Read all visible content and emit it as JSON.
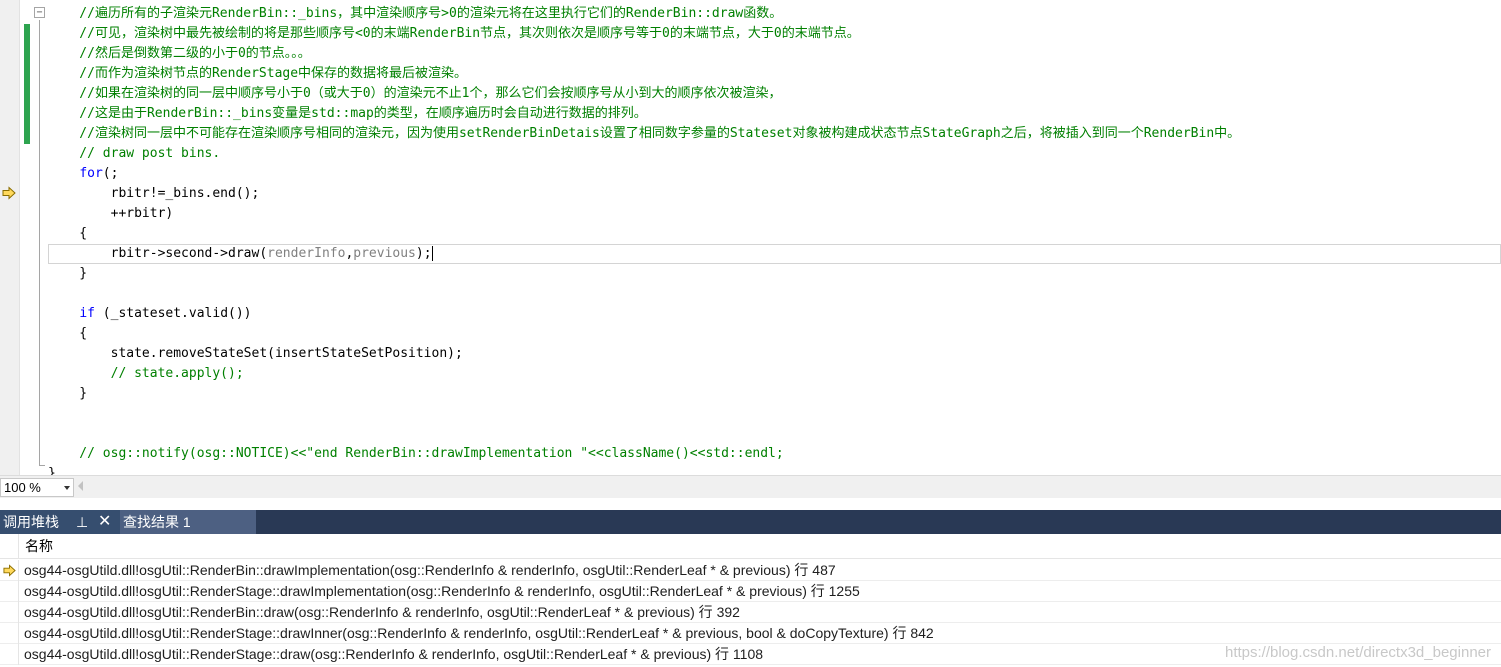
{
  "editor": {
    "lines": [
      [
        {
          "c": "comment",
          "t": "    //遍历所有的子渲染元RenderBin::_bins，其中渲染顺序号>0的渲染元将在这里执行它们的RenderBin::draw函数。"
        }
      ],
      [
        {
          "c": "comment",
          "t": "    //可见，渲染树中最先被绘制的将是那些顺序号<0的末端RenderBin节点，其次则依次是顺序号等于0的末端节点，大于0的末端节点。"
        }
      ],
      [
        {
          "c": "comment",
          "t": "    //然后是倒数第二级的小于0的节点。。。"
        }
      ],
      [
        {
          "c": "comment",
          "t": "    //而作为渲染树节点的RenderStage中保存的数据将最后被渲染。"
        }
      ],
      [
        {
          "c": "comment",
          "t": "    //如果在渲染树的同一层中顺序号小于0（或大于0）的渲染元不止1个，那么它们会按顺序号从小到大的顺序依次被渲染，"
        }
      ],
      [
        {
          "c": "comment",
          "t": "    //这是由于RenderBin::_bins变量是std::map的类型，在顺序遍历时会自动进行数据的排列。"
        }
      ],
      [
        {
          "c": "comment",
          "t": "    //渲染树同一层中不可能存在渲染顺序号相同的渲染元，因为使用setRenderBinDetais设置了相同数字参量的Stateset对象被构建成状态节点StateGraph之后，将被插入到同一个RenderBin中。"
        }
      ],
      [
        {
          "c": "comment",
          "t": "    // draw post bins."
        }
      ],
      [
        {
          "c": "plain",
          "t": "    "
        },
        {
          "c": "keyword",
          "t": "for"
        },
        {
          "c": "plain",
          "t": "(;"
        }
      ],
      [
        {
          "c": "plain",
          "t": "        rbitr!=_bins.end();"
        }
      ],
      [
        {
          "c": "plain",
          "t": "        ++rbitr)"
        }
      ],
      [
        {
          "c": "plain",
          "t": "    {"
        }
      ],
      [
        {
          "c": "plain",
          "t": "        rbitr->second->draw("
        },
        {
          "c": "gray",
          "t": "renderInfo"
        },
        {
          "c": "plain",
          "t": ","
        },
        {
          "c": "gray",
          "t": "previous"
        },
        {
          "c": "plain",
          "t": ");"
        }
      ],
      [
        {
          "c": "plain",
          "t": "    }"
        }
      ],
      [
        {
          "c": "plain",
          "t": ""
        }
      ],
      [
        {
          "c": "plain",
          "t": "    "
        },
        {
          "c": "keyword",
          "t": "if"
        },
        {
          "c": "plain",
          "t": " (_stateset.valid())"
        }
      ],
      [
        {
          "c": "plain",
          "t": "    {"
        }
      ],
      [
        {
          "c": "plain",
          "t": "        state.removeStateSet(insertStateSetPosition);"
        }
      ],
      [
        {
          "c": "comment",
          "t": "        // state.apply();"
        }
      ],
      [
        {
          "c": "plain",
          "t": "    }"
        }
      ],
      [
        {
          "c": "plain",
          "t": ""
        }
      ],
      [
        {
          "c": "plain",
          "t": ""
        }
      ],
      [
        {
          "c": "comment",
          "t": "    // osg::notify(osg::NOTICE)<<\"end RenderBin::drawImplementation \"<<className()<<std::endl;"
        }
      ],
      [
        {
          "c": "plain",
          "t": "}"
        }
      ]
    ],
    "current_line_index": 12,
    "debug_arrow_icon": "yellow-arrow-icon",
    "change_bar_color": "#2ea44f"
  },
  "zoom": {
    "value": "100 %"
  },
  "tool_tabs": {
    "callstack_label": "调用堆栈",
    "pin_glyph": "⊥",
    "close_glyph": "✕",
    "findresults_label": "查找结果 1"
  },
  "callstack": {
    "column_name": "名称",
    "current_frame_index": 0,
    "frames": [
      "osg44-osgUtild.dll!osgUtil::RenderBin::drawImplementation(osg::RenderInfo & renderInfo, osgUtil::RenderLeaf * & previous) 行 487",
      "osg44-osgUtild.dll!osgUtil::RenderStage::drawImplementation(osg::RenderInfo & renderInfo, osgUtil::RenderLeaf * & previous) 行 1255",
      "osg44-osgUtild.dll!osgUtil::RenderBin::draw(osg::RenderInfo & renderInfo, osgUtil::RenderLeaf * & previous) 行 392",
      "osg44-osgUtild.dll!osgUtil::RenderStage::drawInner(osg::RenderInfo & renderInfo, osgUtil::RenderLeaf * & previous, bool & doCopyTexture) 行 842",
      "osg44-osgUtild.dll!osgUtil::RenderStage::draw(osg::RenderInfo & renderInfo, osgUtil::RenderLeaf * & previous) 行 1108"
    ]
  },
  "watermark": "https://blog.csdn.net/directx3d_beginner"
}
